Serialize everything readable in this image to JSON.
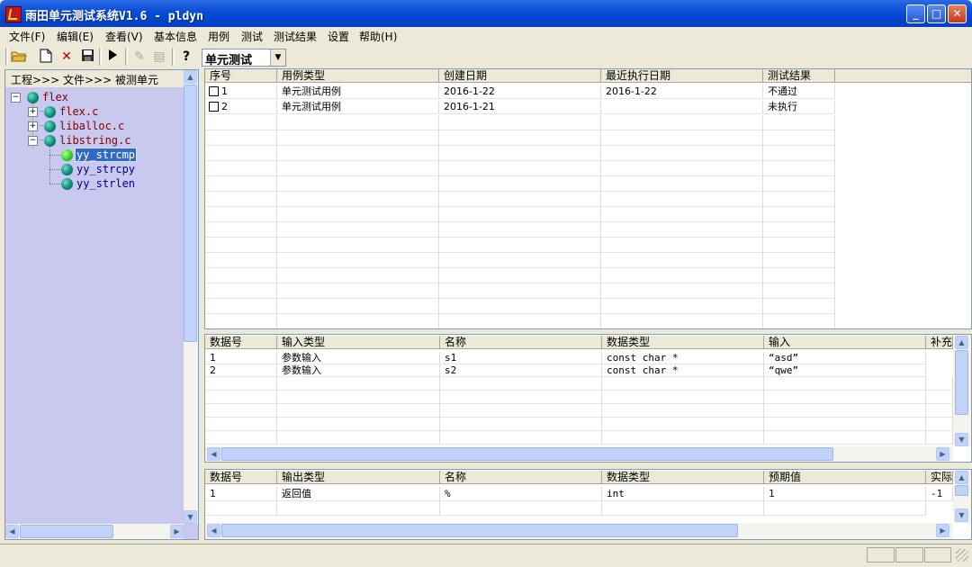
{
  "window": {
    "title": "雨田单元测试系统V1.6 - pldyn",
    "minimize": "_",
    "maximize": "□",
    "close": "✕"
  },
  "menu": [
    "文件(F)",
    "编辑(E)",
    "查看(V)",
    "基本信息",
    "用例",
    "测试",
    "测试结果",
    "设置",
    "帮助(H)"
  ],
  "toolbar": {
    "icons": [
      "open-folder-icon",
      "new-file-icon",
      "delete-icon",
      "save-icon",
      "run-icon",
      "check-icon",
      "report-icon",
      "help-icon"
    ],
    "mode_select": "单元测试"
  },
  "left_panel": {
    "breadcrumb": "工程>>> 文件>>> 被测单元",
    "tree": {
      "root": "flex",
      "files": [
        {
          "name": "flex.c",
          "expander": "+"
        },
        {
          "name": "liballoc.c",
          "expander": "+"
        },
        {
          "name": "libstring.c",
          "expander": "−"
        }
      ],
      "units": [
        "yy_strcmp",
        "yy_strcpy",
        "yy_strlen"
      ],
      "selected_unit": "yy_strcmp"
    }
  },
  "testcase_grid": {
    "headers": [
      "序号",
      "用例类型",
      "创建日期",
      "最近执行日期",
      "测试结果"
    ],
    "rows": [
      [
        "1",
        "单元测试用例",
        "2016-1-22",
        "2016-1-22",
        "不通过"
      ],
      [
        "2",
        "单元测试用例",
        "2016-1-21",
        "",
        "未执行"
      ]
    ]
  },
  "input_grid": {
    "headers": [
      "数据号",
      "输入类型",
      "名称",
      "数据类型",
      "输入",
      "补充"
    ],
    "rows": [
      [
        "1",
        "参数输入",
        "s1",
        "const char *",
        "“asd”",
        ""
      ],
      [
        "2",
        "参数输入",
        "s2",
        "const char *",
        "“qwe”",
        ""
      ]
    ]
  },
  "output_grid": {
    "headers": [
      "数据号",
      "输出类型",
      "名称",
      "数据类型",
      "预期值",
      "实际"
    ],
    "rows": [
      [
        "1",
        "返回值",
        "%",
        "int",
        "1",
        "-1"
      ]
    ]
  },
  "colors": {
    "titlebar": "#0a4fd8",
    "tree_background": "#c9c9f0",
    "selection": "#316ac5",
    "tree_text": "#800000"
  }
}
